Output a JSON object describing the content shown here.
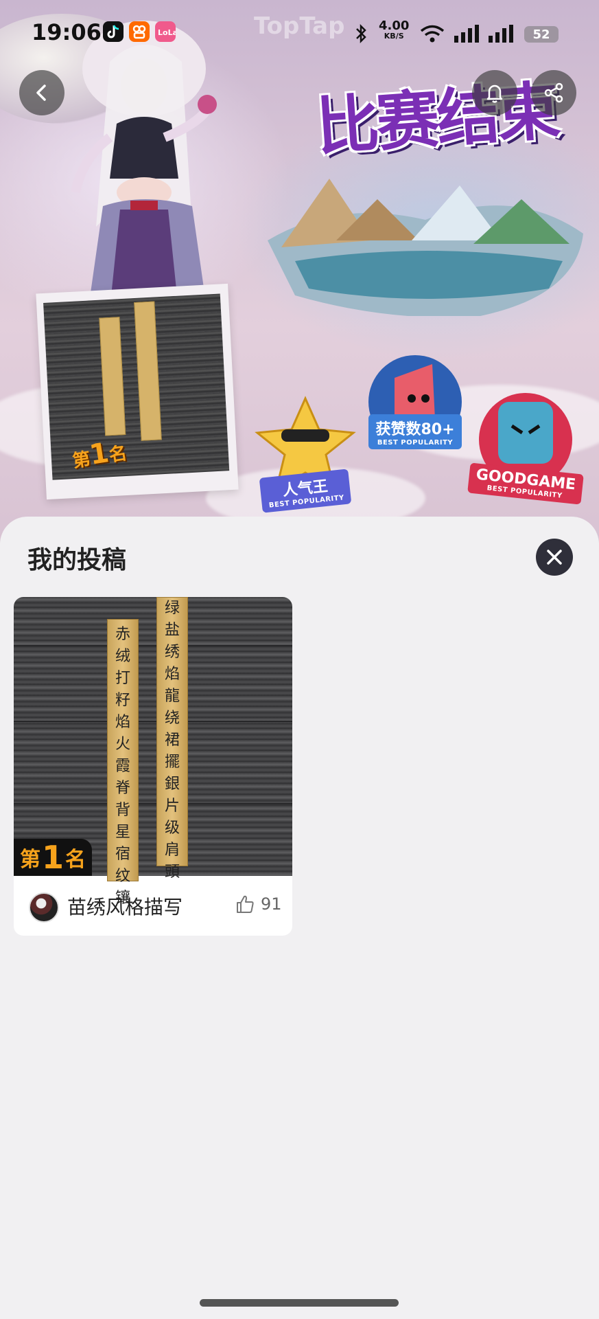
{
  "status_bar": {
    "time": "19:06",
    "net_speed": "4.00",
    "net_speed_unit": "KB/S",
    "battery": "52",
    "apps": [
      "tiktok-icon",
      "kuaishou-icon",
      "lofter-icon"
    ]
  },
  "hero": {
    "watermark": "TopTap",
    "title": "比赛结束",
    "photo_rank": {
      "prefix": "第",
      "num": "1",
      "suffix": "名"
    },
    "badges": [
      {
        "label": "人气王",
        "sub": "BEST POPULARITY",
        "color": "#5a5fd6"
      },
      {
        "label": "获赞数80+",
        "sub": "BEST POPULARITY",
        "color": "#3c7fd9"
      },
      {
        "label": "GOODGAME",
        "sub": "BEST POPULARITY",
        "color": "#d8314f"
      }
    ]
  },
  "sheet": {
    "title": "我的投稿",
    "post": {
      "rank": {
        "prefix": "第",
        "num": "1",
        "suffix": "名"
      },
      "strip_left": [
        "赤",
        "绒",
        "打",
        "籽",
        "焰",
        "火",
        "霞",
        "脊",
        "背",
        "星",
        "宿",
        "纹",
        "镶"
      ],
      "strip_right": [
        "绿",
        "盐",
        "绣",
        "焰",
        "龍",
        "绕",
        "裙",
        "擺",
        "銀",
        "片",
        "级",
        "肩",
        "頭"
      ],
      "author_name": "苗绣风格描写",
      "likes": "91"
    }
  },
  "icons": {
    "back": "chevron-left-icon",
    "notify": "bell-icon",
    "share": "share-icon",
    "close": "close-icon",
    "like": "thumbs-up-icon"
  }
}
